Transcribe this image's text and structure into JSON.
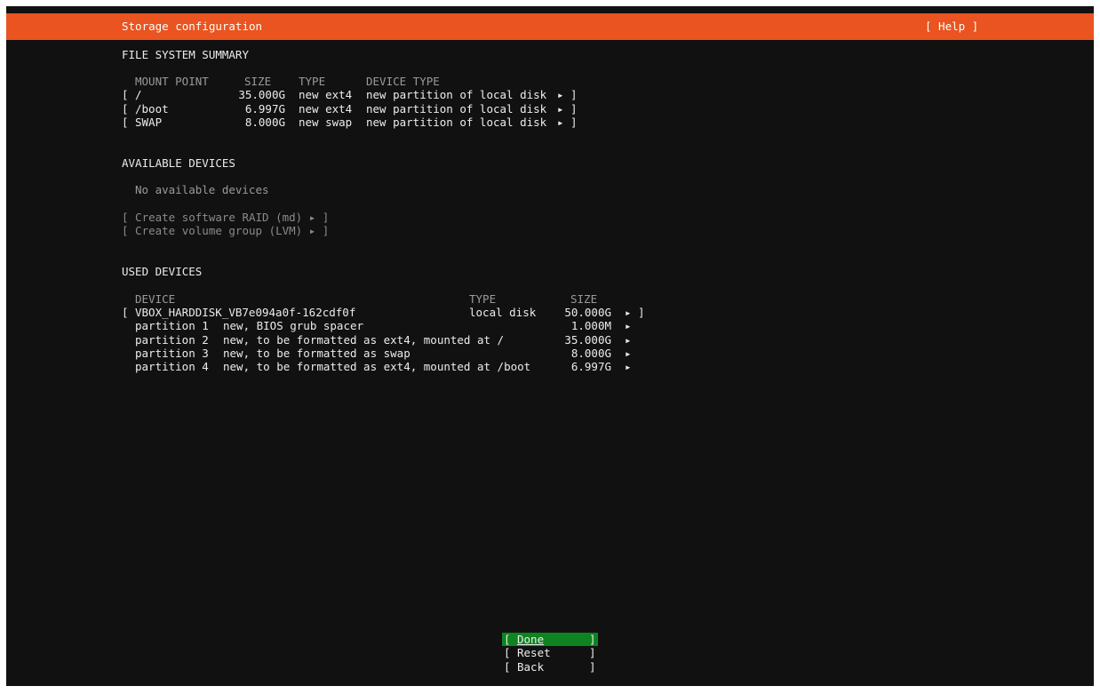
{
  "header": {
    "title": "Storage configuration",
    "help_label": "[ Help ]"
  },
  "fs_summary": {
    "heading": "FILE SYSTEM SUMMARY",
    "columns": {
      "mount": "MOUNT POINT",
      "size": "SIZE",
      "type": "TYPE",
      "device_type": "DEVICE TYPE"
    },
    "rows": [
      {
        "open": "[",
        "mount": "/",
        "size": "35.000G",
        "type": "new ext4",
        "device_type": "new partition of local disk",
        "arrow": "▸",
        "close": "]"
      },
      {
        "open": "[",
        "mount": "/boot",
        "size": "6.997G",
        "type": "new ext4",
        "device_type": "new partition of local disk",
        "arrow": "▸",
        "close": "]"
      },
      {
        "open": "[",
        "mount": "SWAP",
        "size": "8.000G",
        "type": "new swap",
        "device_type": "new partition of local disk",
        "arrow": "▸",
        "close": "]"
      }
    ]
  },
  "available": {
    "heading": "AVAILABLE DEVICES",
    "empty_text": "No available devices",
    "actions": [
      {
        "label": "[ Create software RAID (md) ▸ ]"
      },
      {
        "label": "[ Create volume group (LVM) ▸ ]"
      }
    ]
  },
  "used": {
    "heading": "USED DEVICES",
    "columns": {
      "device": "DEVICE",
      "type": "TYPE",
      "size": "SIZE"
    },
    "disk": {
      "open": "[",
      "device": "VBOX_HARDDISK_VB7e094a0f-162cdf0f",
      "type": "local disk",
      "size": "50.000G",
      "arrow": "▸",
      "close": "]"
    },
    "partitions": [
      {
        "name": "partition 1",
        "desc": "new, BIOS grub spacer",
        "size": "1.000M",
        "arrow": "▸"
      },
      {
        "name": "partition 2",
        "desc": "new, to be formatted as ext4, mounted at /",
        "size": "35.000G",
        "arrow": "▸"
      },
      {
        "name": "partition 3",
        "desc": "new, to be formatted as swap",
        "size": "8.000G",
        "arrow": "▸"
      },
      {
        "name": "partition 4",
        "desc": "new, to be formatted as ext4, mounted at /boot",
        "size": "6.997G",
        "arrow": "▸"
      }
    ]
  },
  "buttons": {
    "done": {
      "open": "[",
      "label": "Done",
      "close": "]"
    },
    "reset": {
      "open": "[",
      "label": "Reset",
      "close": "]"
    },
    "back": {
      "open": "[",
      "label": "Back",
      "close": "]"
    }
  },
  "colors": {
    "header": "#e95420",
    "background": "#111111",
    "selected_button": "#0e8420"
  }
}
